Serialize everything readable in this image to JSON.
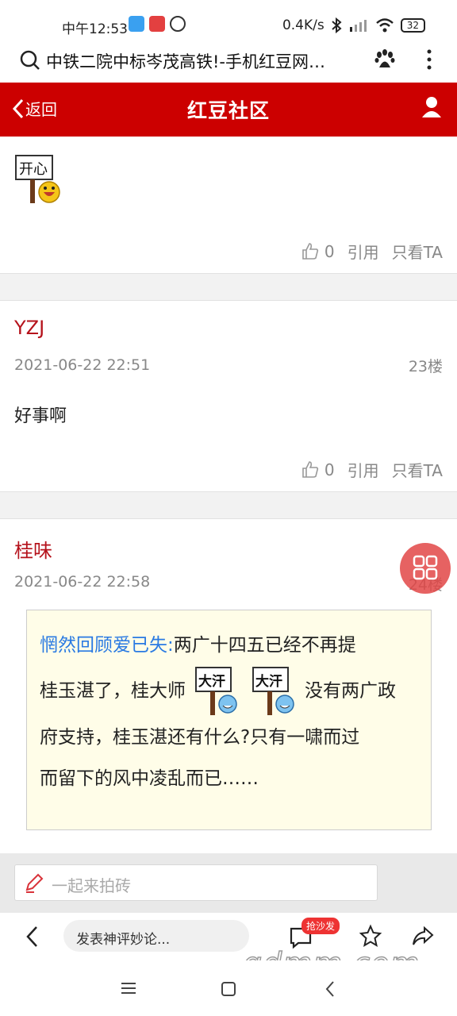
{
  "status": {
    "time": "中午12:53",
    "net_speed": "0.4K/s",
    "battery": "32"
  },
  "browser": {
    "page_title": "中铁二院中标岑茂高铁!-手机红豆网…"
  },
  "header": {
    "back_label": "返回",
    "title": "红豆社区"
  },
  "post_top": {
    "sign_text": "开心",
    "likes": "0",
    "quote_label": "引用",
    "only_label": "只看TA"
  },
  "post_23": {
    "username": "YZJ",
    "datetime": "2021-06-22 22:51",
    "floor": "23楼",
    "content": "好事啊",
    "likes": "0",
    "quote_label": "引用",
    "only_label": "只看TA"
  },
  "post_24": {
    "username": "桂味",
    "datetime": "2021-06-22 22:58",
    "floor": "24楼",
    "quote_name": "惘然回顾爱已失:",
    "quote_line1": "两广十四五已经不再提",
    "quote_line2a": "桂玉湛了，桂大师",
    "quote_line2b": "没有两广政",
    "quote_line3": "府支持，桂玉湛还有什么?只有一啸而过",
    "quote_line4": "而留下的风中凌乱而已……",
    "emo_text": "大汗"
  },
  "reply": {
    "placeholder": "一起来拍砖"
  },
  "bottom": {
    "comment_placeholder": "发表神评妙论...",
    "badge": "抢沙发"
  },
  "watermark": "gdmm.com",
  "colors": {
    "brand_red": "#cc0000",
    "username_red": "#b5121b",
    "quote_blue": "#2a7ae2",
    "quote_bg": "#fffde8"
  }
}
